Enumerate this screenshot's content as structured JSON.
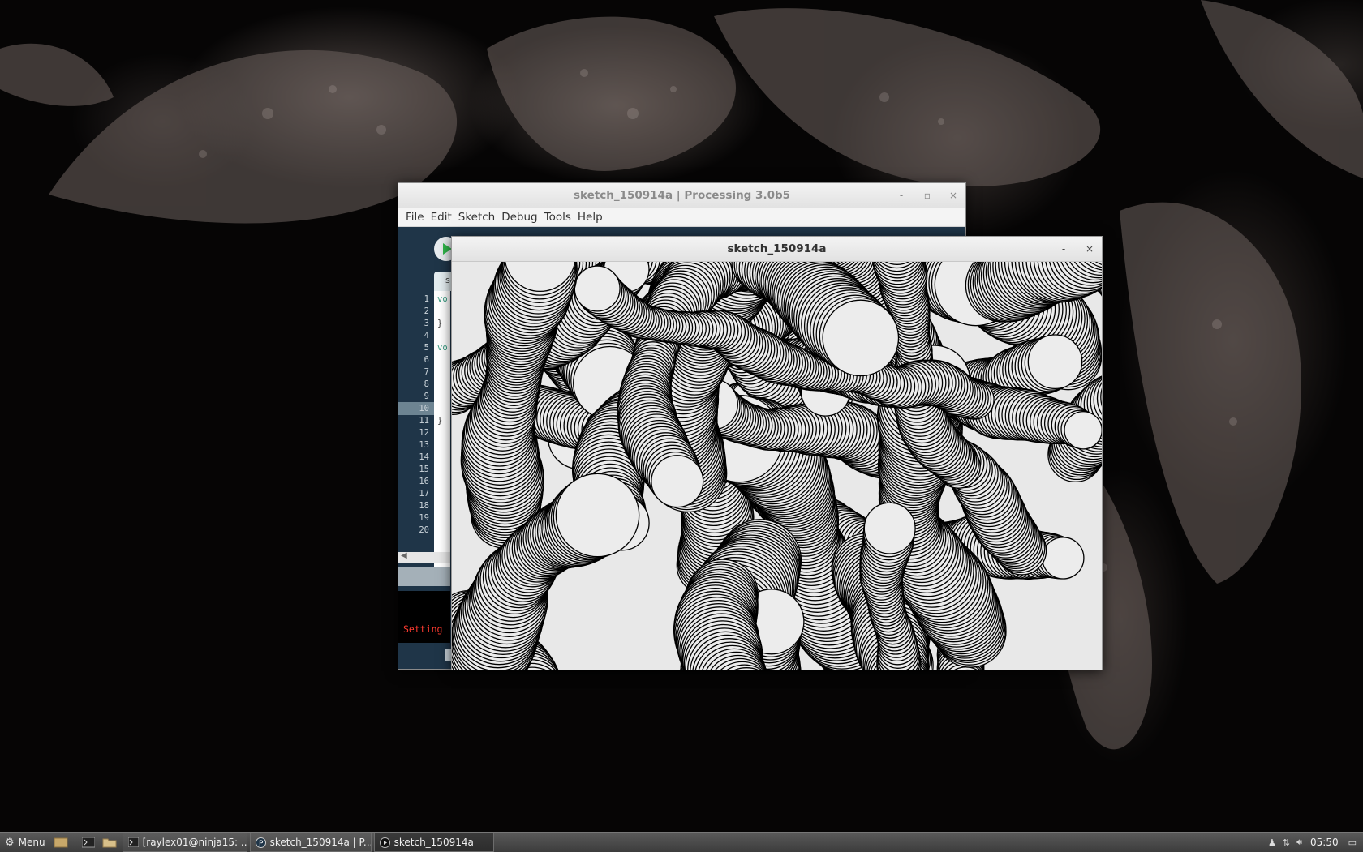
{
  "ide": {
    "title": "sketch_150914a | Processing 3.0b5",
    "minimize": "-",
    "maximize": "▫",
    "close": "×",
    "menus": [
      "File",
      "Edit",
      "Sketch",
      "Debug",
      "Tools",
      "Help"
    ],
    "tab_label": "s",
    "line_numbers": [
      "1",
      "2",
      "3",
      "4",
      "5",
      "6",
      "7",
      "8",
      "9",
      "10",
      "11",
      "12",
      "13",
      "14",
      "15",
      "16",
      "17",
      "18",
      "19",
      "20"
    ],
    "code_lines": {
      "1": "vo",
      "3": "}",
      "5": "vo",
      "11": "}"
    },
    "console_text": "Setting"
  },
  "sketch": {
    "title": "sketch_150914a",
    "minimize": "-",
    "close": "×"
  },
  "taskbar": {
    "menu_label": "Menu",
    "tasks": [
      {
        "label": "[raylex01@ninja15: ...",
        "icon": "terminal-icon"
      },
      {
        "label": "sketch_150914a | P...",
        "icon": "processing-icon"
      },
      {
        "label": "sketch_150914a",
        "icon": "java-app-icon"
      }
    ],
    "clock": "05:50"
  },
  "colors": {
    "ide_background": "#1f3548",
    "run_button": "#2fb64a",
    "console_text": "#ff3b30",
    "taskbar": "#4a4a4a"
  }
}
